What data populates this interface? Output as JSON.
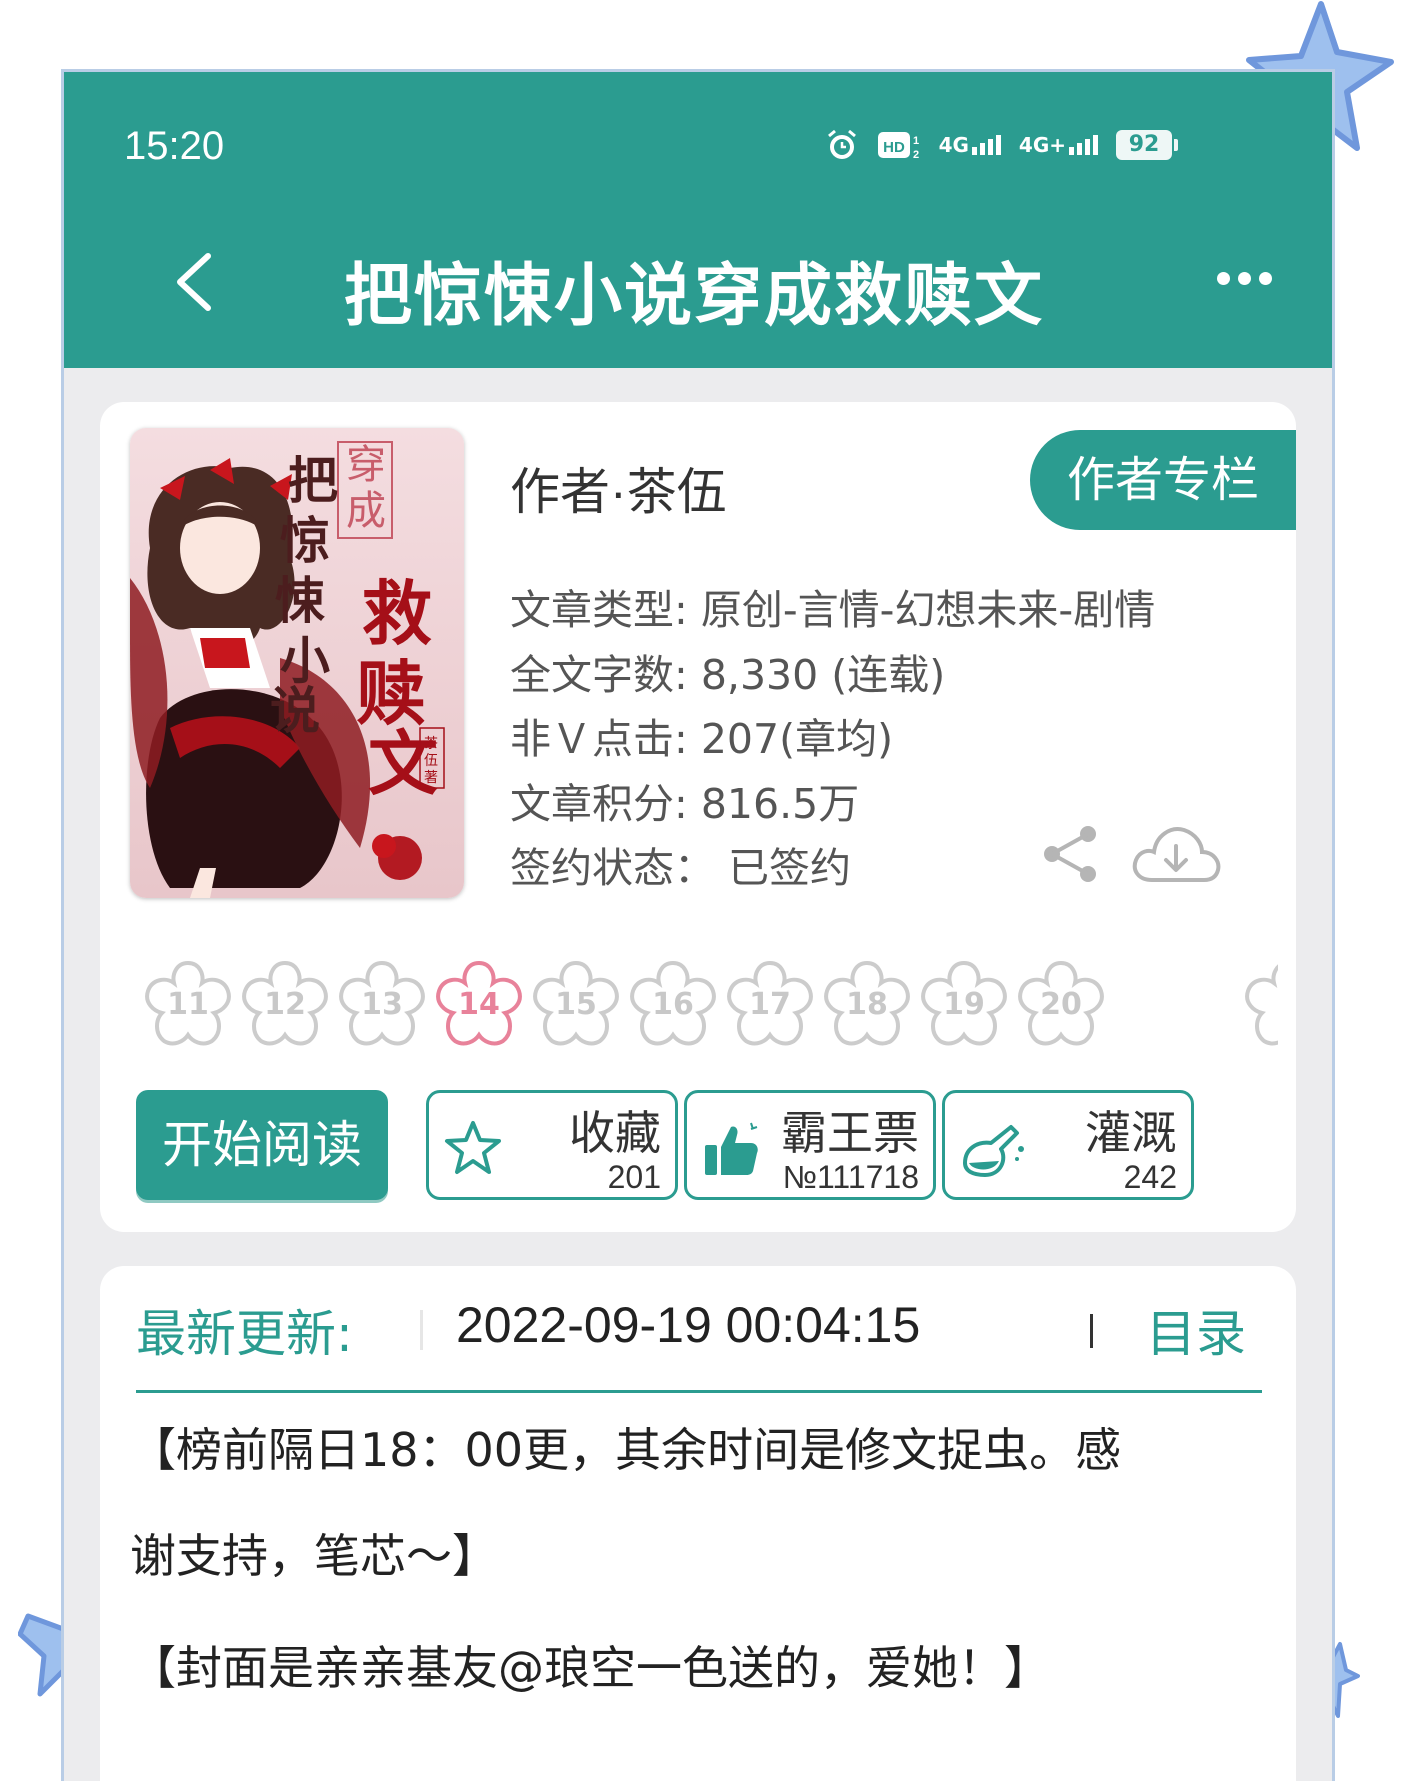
{
  "colors": {
    "accent": "#2b9c90",
    "active_flower": "#e8829a",
    "star": "#8fb2e8"
  },
  "status_bar": {
    "time": "15:20",
    "icons": [
      "alarm-icon",
      "hd-icon",
      "signal-4g-icon",
      "signal-4g-plus-icon",
      "battery-icon"
    ],
    "net1": "4G",
    "net2": "4G+",
    "battery": "92"
  },
  "header": {
    "title": "把惊悚小说穿成救赎文"
  },
  "book": {
    "author": "作者·茶伍",
    "author_column_label": "作者专栏",
    "info": {
      "type": "文章类型: 原创-言情-幻想未来-剧情",
      "word_count": "全文字数: 8,330 (连载)",
      "clicks": "非Ｖ点击: 207(章均)",
      "points": "文章积分: 816.5万",
      "sign_status": "签约状态：  已签约"
    },
    "cover_text": {
      "title_main": "把惊悚小说",
      "title_side": "穿成",
      "title_accent": "救赎文",
      "author": "茶伍著"
    }
  },
  "levels": {
    "items": [
      "11",
      "12",
      "13",
      "14",
      "15",
      "16",
      "17",
      "18",
      "19",
      "20"
    ],
    "active": "14"
  },
  "actions": {
    "start_label": "开始阅读",
    "collect": {
      "label": "收藏",
      "count": "201"
    },
    "vote": {
      "label": "霸王票",
      "count": "№111718"
    },
    "water": {
      "label": "灌溉",
      "count": "242"
    }
  },
  "latest": {
    "label": "最新更新:",
    "time": "2022-09-19 00:04:15",
    "toc_label": "目录"
  },
  "notice": {
    "line1": "【榜前隔日18：00更，其余时间是修文捉虫。感",
    "line2": "谢支持，笔芯～】",
    "line3": "【封面是亲亲基友@琅空一色送的，爱她！】"
  }
}
